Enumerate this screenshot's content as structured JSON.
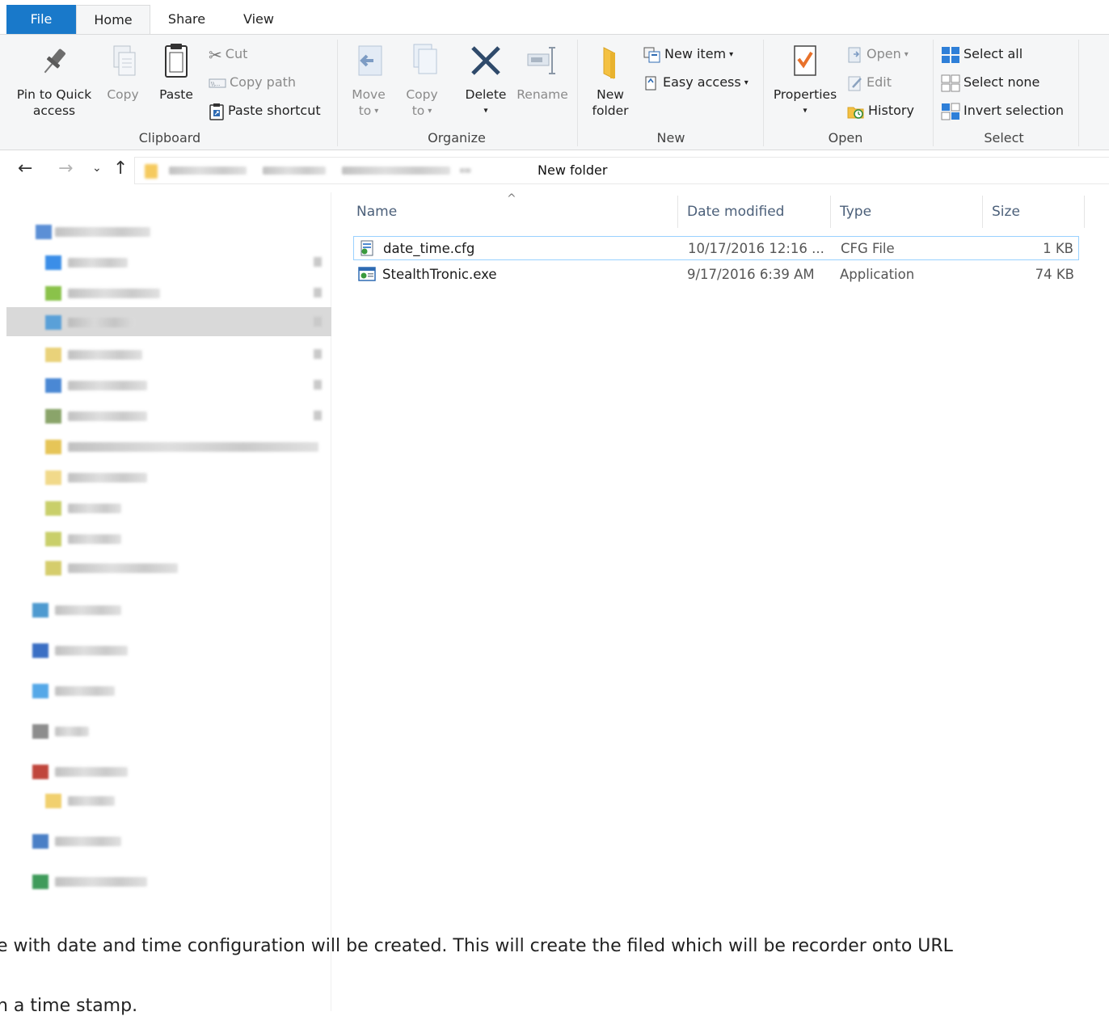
{
  "tabs": {
    "file": "File",
    "home": "Home",
    "share": "Share",
    "view": "View"
  },
  "ribbon": {
    "clipboard": {
      "label": "Clipboard",
      "pin_line1": "Pin to Quick",
      "pin_line2": "access",
      "copy": "Copy",
      "paste": "Paste",
      "cut": "Cut",
      "copy_path": "Copy path",
      "paste_shortcut": "Paste shortcut"
    },
    "organize": {
      "label": "Organize",
      "move_line1": "Move",
      "move_line2": "to",
      "copyto_line1": "Copy",
      "copyto_line2": "to",
      "delete": "Delete",
      "rename": "Rename"
    },
    "new": {
      "label": "New",
      "folder_line1": "New",
      "folder_line2": "folder",
      "new_item": "New item",
      "easy_access": "Easy access"
    },
    "open": {
      "label": "Open",
      "properties": "Properties",
      "open": "Open",
      "edit": "Edit",
      "history": "History"
    },
    "select": {
      "label": "Select",
      "select_all": "Select all",
      "select_none": "Select none",
      "invert": "Invert selection"
    }
  },
  "address": {
    "current_folder": "New folder"
  },
  "columns": {
    "name": "Name",
    "date": "Date modified",
    "type": "Type",
    "size": "Size"
  },
  "files": [
    {
      "name": "date_time.cfg",
      "date": "10/17/2016 12:16 ...",
      "type": "CFG File",
      "size": "1 KB"
    },
    {
      "name": "StealthTronic.exe",
      "date": "9/17/2016 6:39 AM",
      "type": "Application",
      "size": "74 KB"
    }
  ],
  "caption": {
    "line1": "e with date and time configuration will be created. This will create the filed which will be recorder onto URL",
    "line2": "h a time stamp."
  },
  "colors": {
    "file_tab": "#1979ca",
    "ribbon_bg": "#f5f6f7",
    "selection_border": "#99d1ff",
    "header_text": "#4c607a"
  }
}
